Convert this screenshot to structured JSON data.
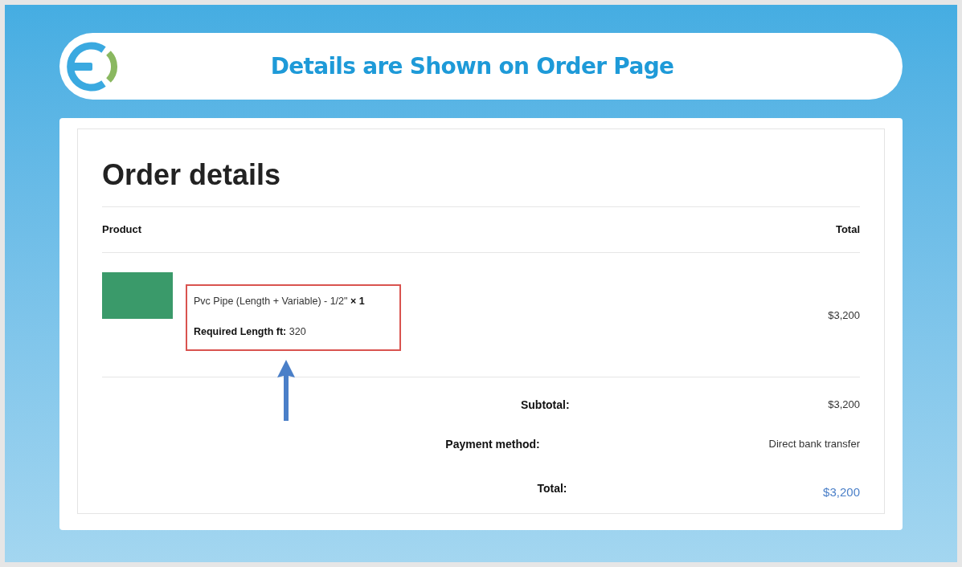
{
  "banner": {
    "title": "Details are Shown on Order Page"
  },
  "order": {
    "heading": "Order details",
    "columns": [
      "Product",
      "Total"
    ],
    "items": [
      {
        "name": "Pvc Pipe (Length + Variable) - 1/2\"",
        "quantity": "× 1",
        "meta_label": "Required Length ft:",
        "meta_value": "320",
        "total": "$3,200",
        "highlighted": true
      }
    ],
    "totals": [
      {
        "label": "Subtotal:",
        "value": "$3,200",
        "kind": "plain"
      },
      {
        "label": "Payment method:",
        "value": "Direct bank transfer",
        "kind": "plain"
      },
      {
        "label": "Total:",
        "value": "$3,200",
        "kind": "grand"
      }
    ]
  }
}
